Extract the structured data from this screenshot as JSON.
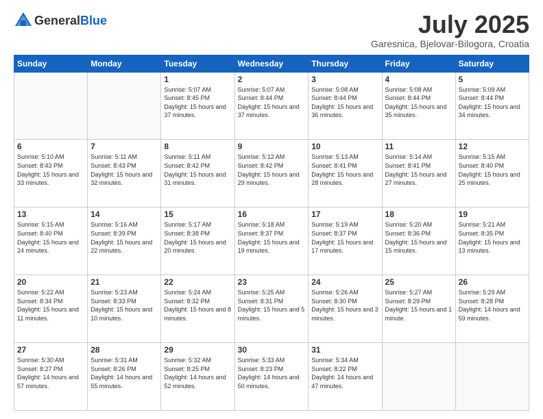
{
  "header": {
    "logo_general": "General",
    "logo_blue": "Blue",
    "month": "July 2025",
    "location": "Garesnica, Bjelovar-Bilogora, Croatia"
  },
  "days_of_week": [
    "Sunday",
    "Monday",
    "Tuesday",
    "Wednesday",
    "Thursday",
    "Friday",
    "Saturday"
  ],
  "weeks": [
    [
      {
        "day": "",
        "info": ""
      },
      {
        "day": "",
        "info": ""
      },
      {
        "day": "1",
        "info": "Sunrise: 5:07 AM\nSunset: 8:45 PM\nDaylight: 15 hours and 37 minutes."
      },
      {
        "day": "2",
        "info": "Sunrise: 5:07 AM\nSunset: 8:44 PM\nDaylight: 15 hours and 37 minutes."
      },
      {
        "day": "3",
        "info": "Sunrise: 5:08 AM\nSunset: 8:44 PM\nDaylight: 15 hours and 36 minutes."
      },
      {
        "day": "4",
        "info": "Sunrise: 5:08 AM\nSunset: 8:44 PM\nDaylight: 15 hours and 35 minutes."
      },
      {
        "day": "5",
        "info": "Sunrise: 5:09 AM\nSunset: 8:44 PM\nDaylight: 15 hours and 34 minutes."
      }
    ],
    [
      {
        "day": "6",
        "info": "Sunrise: 5:10 AM\nSunset: 8:43 PM\nDaylight: 15 hours and 33 minutes."
      },
      {
        "day": "7",
        "info": "Sunrise: 5:11 AM\nSunset: 8:43 PM\nDaylight: 15 hours and 32 minutes."
      },
      {
        "day": "8",
        "info": "Sunrise: 5:11 AM\nSunset: 8:42 PM\nDaylight: 15 hours and 31 minutes."
      },
      {
        "day": "9",
        "info": "Sunrise: 5:12 AM\nSunset: 8:42 PM\nDaylight: 15 hours and 29 minutes."
      },
      {
        "day": "10",
        "info": "Sunrise: 5:13 AM\nSunset: 8:41 PM\nDaylight: 15 hours and 28 minutes."
      },
      {
        "day": "11",
        "info": "Sunrise: 5:14 AM\nSunset: 8:41 PM\nDaylight: 15 hours and 27 minutes."
      },
      {
        "day": "12",
        "info": "Sunrise: 5:15 AM\nSunset: 8:40 PM\nDaylight: 15 hours and 25 minutes."
      }
    ],
    [
      {
        "day": "13",
        "info": "Sunrise: 5:15 AM\nSunset: 8:40 PM\nDaylight: 15 hours and 24 minutes."
      },
      {
        "day": "14",
        "info": "Sunrise: 5:16 AM\nSunset: 8:39 PM\nDaylight: 15 hours and 22 minutes."
      },
      {
        "day": "15",
        "info": "Sunrise: 5:17 AM\nSunset: 8:38 PM\nDaylight: 15 hours and 20 minutes."
      },
      {
        "day": "16",
        "info": "Sunrise: 5:18 AM\nSunset: 8:37 PM\nDaylight: 15 hours and 19 minutes."
      },
      {
        "day": "17",
        "info": "Sunrise: 5:19 AM\nSunset: 8:37 PM\nDaylight: 15 hours and 17 minutes."
      },
      {
        "day": "18",
        "info": "Sunrise: 5:20 AM\nSunset: 8:36 PM\nDaylight: 15 hours and 15 minutes."
      },
      {
        "day": "19",
        "info": "Sunrise: 5:21 AM\nSunset: 8:35 PM\nDaylight: 15 hours and 13 minutes."
      }
    ],
    [
      {
        "day": "20",
        "info": "Sunrise: 5:22 AM\nSunset: 8:34 PM\nDaylight: 15 hours and 11 minutes."
      },
      {
        "day": "21",
        "info": "Sunrise: 5:23 AM\nSunset: 8:33 PM\nDaylight: 15 hours and 10 minutes."
      },
      {
        "day": "22",
        "info": "Sunrise: 5:24 AM\nSunset: 8:32 PM\nDaylight: 15 hours and 8 minutes."
      },
      {
        "day": "23",
        "info": "Sunrise: 5:25 AM\nSunset: 8:31 PM\nDaylight: 15 hours and 5 minutes."
      },
      {
        "day": "24",
        "info": "Sunrise: 5:26 AM\nSunset: 8:30 PM\nDaylight: 15 hours and 3 minutes."
      },
      {
        "day": "25",
        "info": "Sunrise: 5:27 AM\nSunset: 8:29 PM\nDaylight: 15 hours and 1 minute."
      },
      {
        "day": "26",
        "info": "Sunrise: 5:29 AM\nSunset: 8:28 PM\nDaylight: 14 hours and 59 minutes."
      }
    ],
    [
      {
        "day": "27",
        "info": "Sunrise: 5:30 AM\nSunset: 8:27 PM\nDaylight: 14 hours and 57 minutes."
      },
      {
        "day": "28",
        "info": "Sunrise: 5:31 AM\nSunset: 8:26 PM\nDaylight: 14 hours and 55 minutes."
      },
      {
        "day": "29",
        "info": "Sunrise: 5:32 AM\nSunset: 8:25 PM\nDaylight: 14 hours and 52 minutes."
      },
      {
        "day": "30",
        "info": "Sunrise: 5:33 AM\nSunset: 8:23 PM\nDaylight: 14 hours and 50 minutes."
      },
      {
        "day": "31",
        "info": "Sunrise: 5:34 AM\nSunset: 8:22 PM\nDaylight: 14 hours and 47 minutes."
      },
      {
        "day": "",
        "info": ""
      },
      {
        "day": "",
        "info": ""
      }
    ]
  ]
}
